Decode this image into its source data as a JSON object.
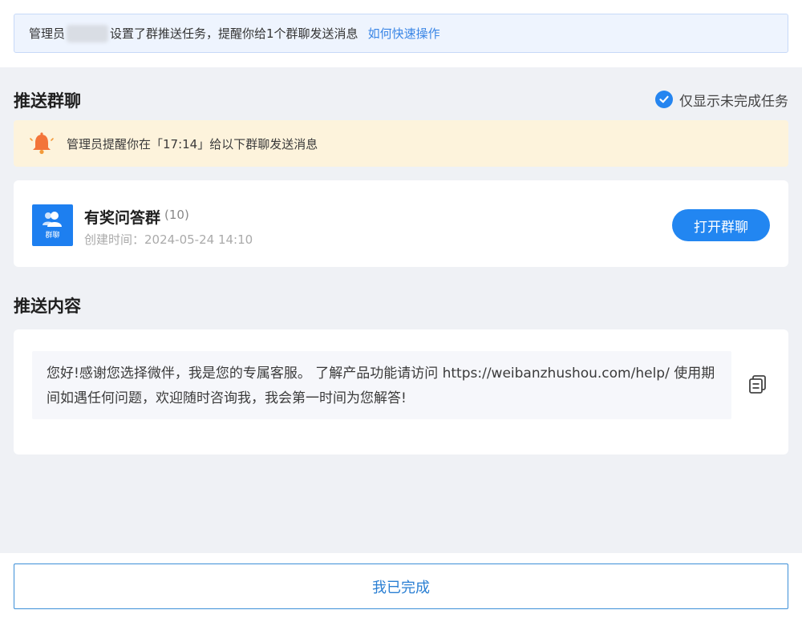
{
  "notice": {
    "prefix": "管理员",
    "suffix": "设置了群推送任务，提醒你给1个群聊发送消息",
    "link": "如何快速操作"
  },
  "push_groups": {
    "title": "推送群聊",
    "filter_label": "仅显示未完成任务",
    "reminder": "管理员提醒你在「17:14」给以下群聊发送消息"
  },
  "group": {
    "avatar_label": "群聊",
    "name": "有奖问答群",
    "count": "(10)",
    "created": "创建时间：2024-05-24 14:10",
    "open_button": "打开群聊"
  },
  "push_content": {
    "title": "推送内容",
    "message": "您好!感谢您选择微伴，我是您的专属客服。 了解产品功能请访问 https://weibanzhushou.com/help/ 使用期间如遇任何问题，欢迎随时咨询我，我会第一时间为您解答!"
  },
  "footer": {
    "done_button": "我已完成"
  },
  "colors": {
    "accent": "#2286f1",
    "reminder_bg": "#fdf3dc",
    "notice_bg": "#eef4fe"
  }
}
